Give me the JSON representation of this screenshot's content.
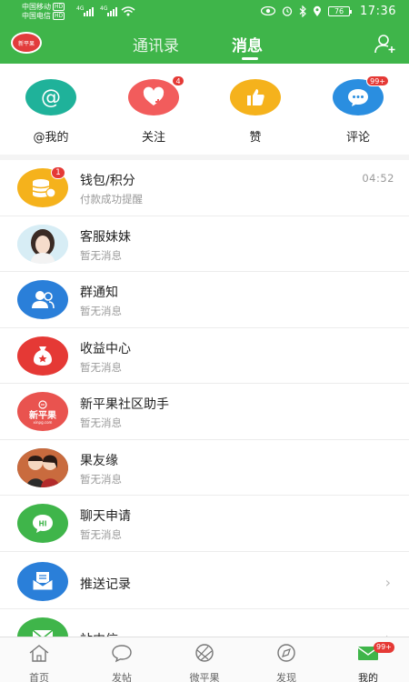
{
  "status_bar": {
    "carrier1": "中国移动",
    "carrier2": "中国电信",
    "hd": "HD",
    "net_4g": "4G",
    "battery": "76",
    "time": "17:36"
  },
  "header": {
    "logo_text": "新平果",
    "tabs": [
      {
        "label": "通讯录"
      },
      {
        "label": "消息"
      }
    ],
    "active_tab": "消息"
  },
  "quick_actions": [
    {
      "label": "@我的",
      "color": "#1fb29a",
      "icon": "at-icon"
    },
    {
      "label": "关注",
      "color": "#f25c5c",
      "icon": "heart-plus-icon",
      "badge": "4"
    },
    {
      "label": "赞",
      "color": "#f5b21c",
      "icon": "thumbs-up-icon"
    },
    {
      "label": "评论",
      "color": "#2a8ee0",
      "icon": "comment-icon",
      "badge": "99+"
    }
  ],
  "messages": [
    {
      "title": "钱包/积分",
      "sub": "付款成功提醒",
      "time": "04:52",
      "badge": "1",
      "icon": "wallet-coins-icon",
      "color": "#f5b21c"
    },
    {
      "title": "客服妹妹",
      "sub": "暂无消息",
      "icon": "customer-service-avatar",
      "color": "#cfe6f2"
    },
    {
      "title": "群通知",
      "sub": "暂无消息",
      "icon": "group-icon",
      "color": "#2a7fd9"
    },
    {
      "title": "收益中心",
      "sub": "暂无消息",
      "icon": "money-bag-icon",
      "color": "#e53935"
    },
    {
      "title": "新平果社区助手",
      "sub": "暂无消息",
      "icon": "community-logo-icon",
      "color": "#e9534f"
    },
    {
      "title": "果友缘",
      "sub": "暂无消息",
      "icon": "couple-avatar",
      "color": "#5a3a2a"
    },
    {
      "title": "聊天申请",
      "sub": "暂无消息",
      "icon": "hi-chat-icon",
      "color": "#3fb54a"
    },
    {
      "title": "推送记录",
      "icon": "push-record-icon",
      "color": "#2a7fd9"
    },
    {
      "title": "站内信",
      "icon": "mail-icon",
      "color": "#3fb54a"
    }
  ],
  "bottom_nav": [
    {
      "label": "首页",
      "icon": "home-icon"
    },
    {
      "label": "发帖",
      "icon": "post-bubble-icon"
    },
    {
      "label": "微平果",
      "icon": "micro-app-icon"
    },
    {
      "label": "发现",
      "icon": "discover-icon"
    },
    {
      "label": "我的",
      "icon": "mine-mail-icon",
      "badge": "99+",
      "active": true
    }
  ]
}
